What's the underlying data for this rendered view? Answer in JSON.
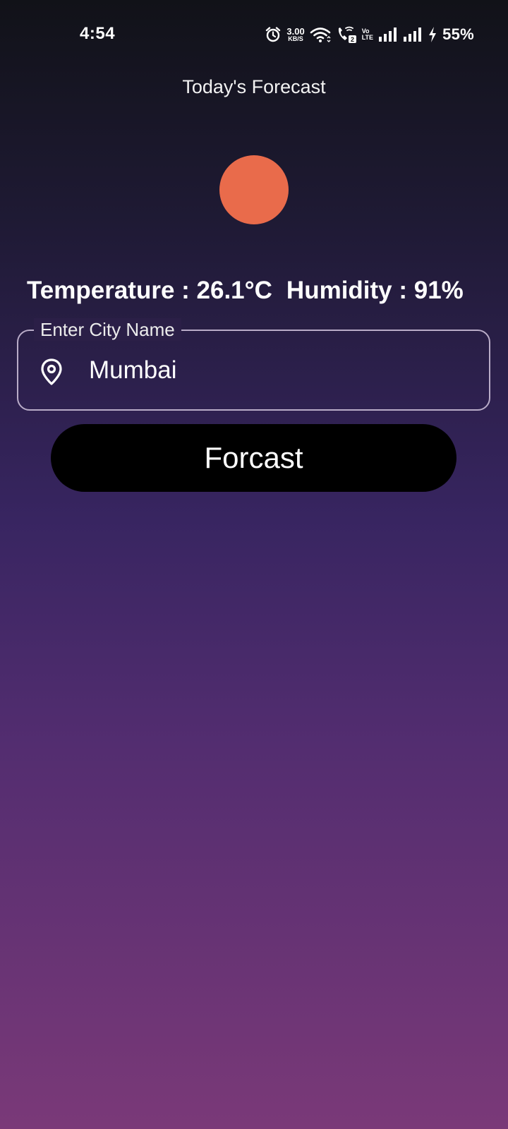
{
  "status_bar": {
    "time": "4:54",
    "net_speed_value": "3.00",
    "net_speed_unit": "KB/S",
    "volte_top": "Vo",
    "volte_bottom": "LTE",
    "battery": "55%",
    "icons": [
      "alarm-icon",
      "wifi-icon",
      "wifi-calling-icon",
      "signal-icon",
      "signal-icon",
      "charging-icon"
    ]
  },
  "header": {
    "title": "Today's Forecast"
  },
  "weather": {
    "icon": "sun-icon",
    "temperature_text": "Temperature : 26.1°C",
    "humidity_text": "Humidity : 91%"
  },
  "city_input": {
    "label": "Enter City Name",
    "value": "Mumbai",
    "icon": "location-pin-icon"
  },
  "actions": {
    "forecast_label": "Forcast"
  },
  "colors": {
    "sun": "#e96b4b",
    "button_bg": "#000000",
    "gradient_top": "#111218",
    "gradient_bottom": "#7a3978",
    "input_border": "#b9acc8"
  }
}
